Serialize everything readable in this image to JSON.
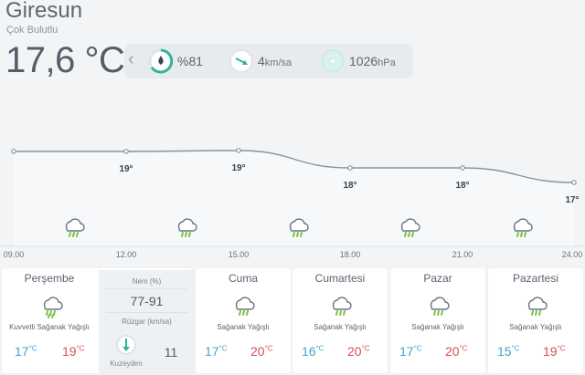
{
  "header": {
    "city": "Giresun",
    "condition": "Çok Bulutlu",
    "temperature": "17,6 °C"
  },
  "metrics": {
    "humidity": "%81",
    "wind_value": "4",
    "wind_unit": "km/sa",
    "pressure_value": "1026",
    "pressure_unit": "hPa"
  },
  "hourly": {
    "times": [
      "09.00",
      "12.00",
      "15.00",
      "18.00",
      "21.00",
      "24.00"
    ],
    "temps": [
      19,
      19,
      19,
      18,
      18,
      17
    ],
    "temp_labels": [
      "19°",
      "19°",
      "18°",
      "18°",
      "17°"
    ],
    "icon": "rain-cloud-icon"
  },
  "today": {
    "day": "Perşembe",
    "desc": "Kuvvetli Sağanak Yağışlı",
    "lo": "17",
    "hi": "19",
    "deg": "°C",
    "humidity_label": "Nem (%)",
    "humidity_value": "77-91",
    "wind_label": "Rüzgar (km/sa)",
    "wind_dir": "Kuzeyden",
    "wind_speed": "11"
  },
  "days": [
    {
      "day": "Cuma",
      "desc": "Sağanak Yağışlı",
      "lo": "17",
      "hi": "20"
    },
    {
      "day": "Cumartesi",
      "desc": "Sağanak Yağışlı",
      "lo": "16",
      "hi": "20"
    },
    {
      "day": "Pazar",
      "desc": "Sağanak Yağışlı",
      "lo": "17",
      "hi": "20"
    },
    {
      "day": "Pazartesi",
      "desc": "Sağanak Yağışlı",
      "lo": "15",
      "hi": "19"
    }
  ],
  "colors": {
    "accent": "#2fb39a",
    "low_temp": "#3fa4cf",
    "high_temp": "#d8504e",
    "rain_drop": "#7cc243"
  }
}
